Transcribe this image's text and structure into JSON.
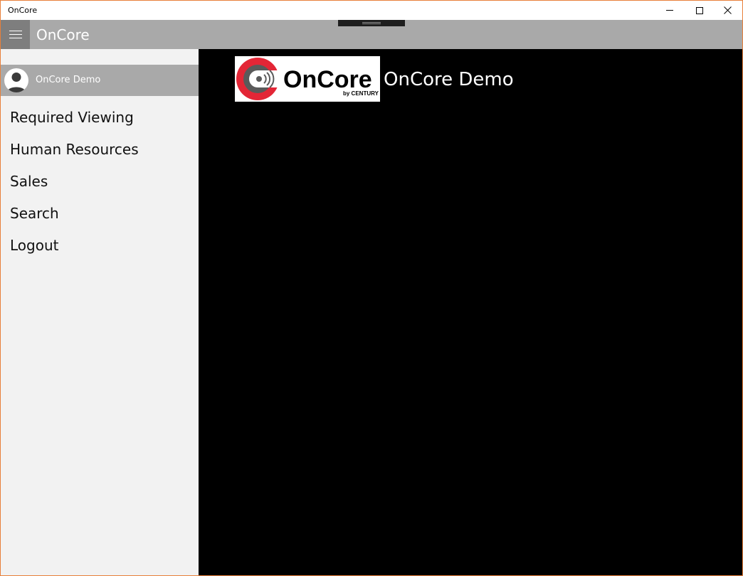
{
  "window": {
    "title": "OnCore",
    "controls": [
      "minimize-icon",
      "maximize-icon",
      "close-icon"
    ]
  },
  "header": {
    "app_title": "OnCore",
    "menu_icon": "hamburger-icon"
  },
  "sidebar": {
    "user": {
      "name": "OnCore Demo",
      "icon": "avatar-icon"
    },
    "items": [
      {
        "label": "Required Viewing"
      },
      {
        "label": "Human Resources"
      },
      {
        "label": "Sales"
      },
      {
        "label": "Search"
      },
      {
        "label": "Logout"
      }
    ]
  },
  "main": {
    "logo": {
      "text": "OnCore",
      "tagline": "by CENTURY",
      "icon": "oncore-logo-icon"
    },
    "title": "OnCore Demo"
  },
  "colors": {
    "window_border": "#e8803a",
    "header_bg": "#a9a9a9",
    "hamburger_bg": "#7e7e7e",
    "sidebar_bg": "#f2f2f2",
    "main_bg": "#000000",
    "logo_red": "#e32636",
    "logo_gray": "#5a5a5a"
  }
}
